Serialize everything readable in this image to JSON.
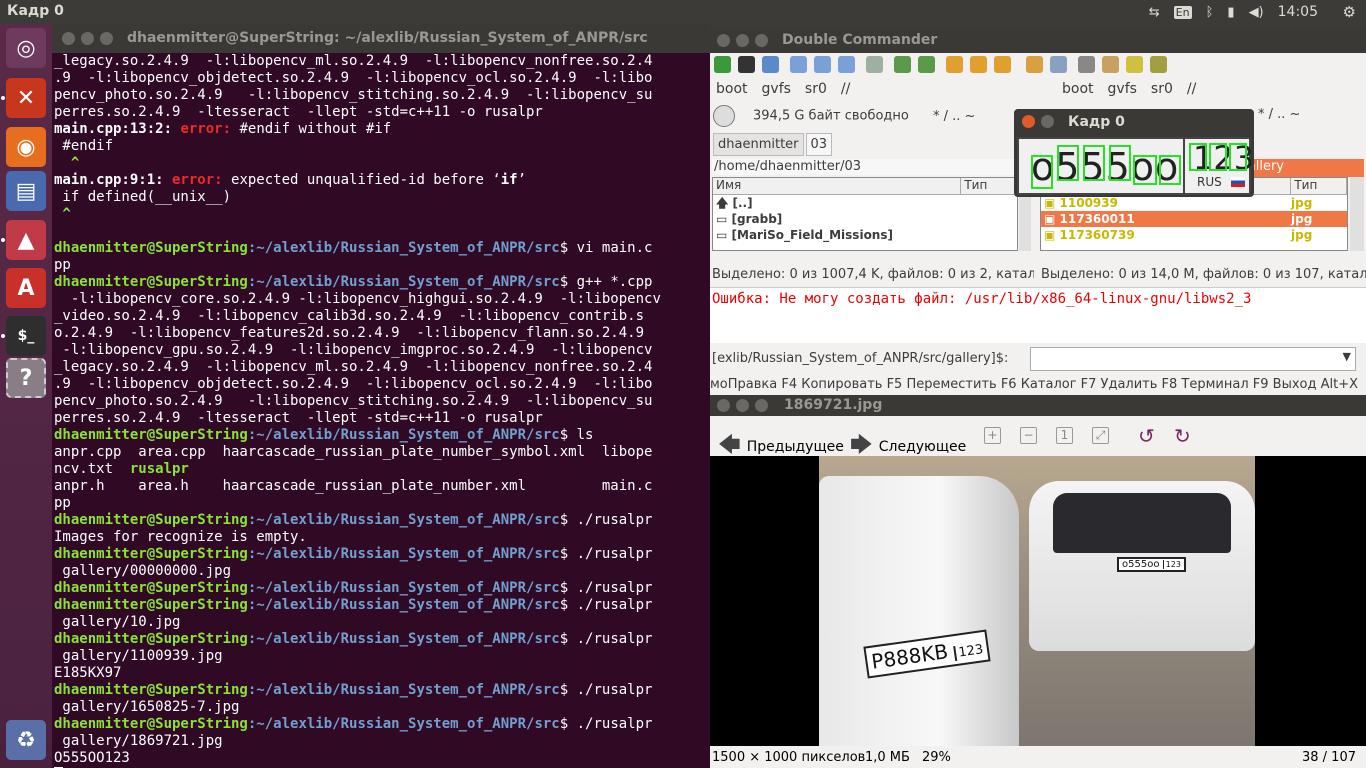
{
  "topbar": {
    "app_title": "Кадр 0",
    "lang": "En",
    "clock": "14:05"
  },
  "launcher": {
    "items": [
      "ubuntu-dash",
      "double-commander",
      "firefox",
      "libreoffice-writer",
      "image-viewer",
      "ubuntu-software",
      "terminal",
      "help",
      "trash"
    ]
  },
  "terminal": {
    "title": "dhaenmitter@SuperString: ~/alexlib/Russian_System_of_ANPR/src",
    "prompt_user": "dhaenmitter@SuperString",
    "prompt_path": ":~/alexlib/Russian_System_of_ANPR/src",
    "lines": {
      "l1": "_legacy.so.2.4.9  -l:libopencv_ml.so.2.4.9  -l:libopencv_nonfree.so.2.4",
      "l2": ".9  -l:libopencv_objdetect.so.2.4.9  -l:libopencv_ocl.so.2.4.9  -l:libo",
      "l3": "pencv_photo.so.2.4.9   -l:libopencv_stitching.so.2.4.9  -l:libopencv_su",
      "l4": "perres.so.2.4.9  -ltesseract  -llept -std=c++11 -o rusalpr",
      "l5a": "main.cpp:13:2:",
      "l5b": " error:",
      "l5c": " #endif without #if",
      "l6": " #endif",
      "l7": "  ^",
      "l8a": "main.cpp:9:1:",
      "l8b": " error:",
      "l8c": " expected unqualified-id before ‘",
      "l8d": "if",
      "l8e": "’",
      "l9": " if defined(__unix__)",
      "l10": " ^",
      "c1": "$ vi main.c",
      "l12": "pp",
      "c2": "$ g++ *.cpp",
      "l14": "  -l:libopencv_core.so.2.4.9 -l:libopencv_highgui.so.2.4.9  -l:libopencv",
      "l15": "_video.so.2.4.9  -l:libopencv_calib3d.so.2.4.9  -l:libopencv_contrib.s",
      "l16": "o.2.4.9  -l:libopencv_features2d.so.2.4.9  -l:libopencv_flann.so.2.4.9",
      "l17": " -l:libopencv_gpu.so.2.4.9  -l:libopencv_imgproc.so.2.4.9  -l:libopencv",
      "l18": "_legacy.so.2.4.9  -l:libopencv_ml.so.2.4.9  -l:libopencv_nonfree.so.2.4",
      "l19": ".9  -l:libopencv_objdetect.so.2.4.9  -l:libopencv_ocl.so.2.4.9  -l:libo",
      "l20": "pencv_photo.so.2.4.9   -l:libopencv_stitching.so.2.4.9  -l:libopencv_su",
      "l21": "perres.so.2.4.9  -ltesseract  -llept -std=c++11 -o rusalpr",
      "c3": "$ ls",
      "l23": "anpr.cpp  area.cpp  haarcascade_russian_plate_number_symbol.xml  libope",
      "l24a": "ncv.txt  ",
      "l24b": "rusalpr",
      "l25": "anpr.h    area.h    haarcascade_russian_plate_number.xml         main.c",
      "l26": "pp",
      "c4": "$ ./rusalpr",
      "l28": "Images for recognize is empty.",
      "c5": "$ ./rusalpr",
      "l30": " gallery/00000000.jpg",
      "c6": "$ ./rusalpr",
      "c7": "$ ./rusalpr",
      "l33": " gallery/10.jpg",
      "c8": "$ ./rusalpr",
      "l35": " gallery/1100939.jpg",
      "l36": "E185KX97",
      "c9": "$ ./rusalpr",
      "l38": " gallery/1650825-7.jpg",
      "c10": "$ ./rusalpr",
      "l40": " gallery/1869721.jpg",
      "l41": "O555OO123"
    }
  },
  "commander": {
    "title": "Double Commander",
    "drives_left": [
      "boot",
      "gvfs",
      "sr0",
      "//"
    ],
    "drives_right": [
      "boot",
      "gvfs",
      "sr0",
      "//"
    ],
    "free_space": "394,5 G байт свободно",
    "nav_symbols": "*   /   ..   ~",
    "nav_symbols_right": "*   /   ..   ~",
    "tabs": [
      "dhaenmitter",
      "03"
    ],
    "left_path": "/home/dhaenmitter/03",
    "right_path_tail": "gallery",
    "col_name": "Имя",
    "col_type": "Тип",
    "left_rows": [
      "[..]",
      "[grabb]",
      "[MariSo_Field_Missions]"
    ],
    "right_rows": [
      {
        "name": "1100939",
        "type": "jpg"
      },
      {
        "name": "117360011",
        "type": "jpg"
      },
      {
        "name": "117360739",
        "type": "jpg"
      }
    ],
    "left_status": "Выделено: 0 из 1007,4 K, файлов: 0 из 2, катало",
    "right_status": "Выделено: 0 из 14,0 M, файлов: 0 из 107, катало",
    "error": "Ошибка: Не могу создать файл: /usr/lib/x86_64-linux-gnu/libws2_3",
    "cmd_label": "[exlib/Russian_System_of_ANPR/src/gallery]$:",
    "fkeys": "моПравка F4 Копировать F5 Переместить F6 Каталог F7 Удалить F8 Терминал F9 Выход Alt+X"
  },
  "popup": {
    "title": "Кадр 0",
    "plate_main": "o555oo",
    "plate_region": "123",
    "plate_country": "RUS"
  },
  "viewer": {
    "title": "1869721.jpg",
    "prev": "Предыдущее",
    "next": "Следующее",
    "plate_left": "P888KB",
    "plate_left_region": "123",
    "plate_right": "o555oo",
    "plate_right_region": "123",
    "status_dims": "1500 × 1000 пикселов",
    "status_size": "1,0 МБ",
    "status_zoom": "29%",
    "status_index": "38 / 107"
  },
  "colors": {
    "terminal_bg": "#300a24",
    "prompt_user": "#8ae234",
    "prompt_path": "#729fcf",
    "error": "#ef2929",
    "selection": "#f07746",
    "launcher": "#5a2a48"
  }
}
